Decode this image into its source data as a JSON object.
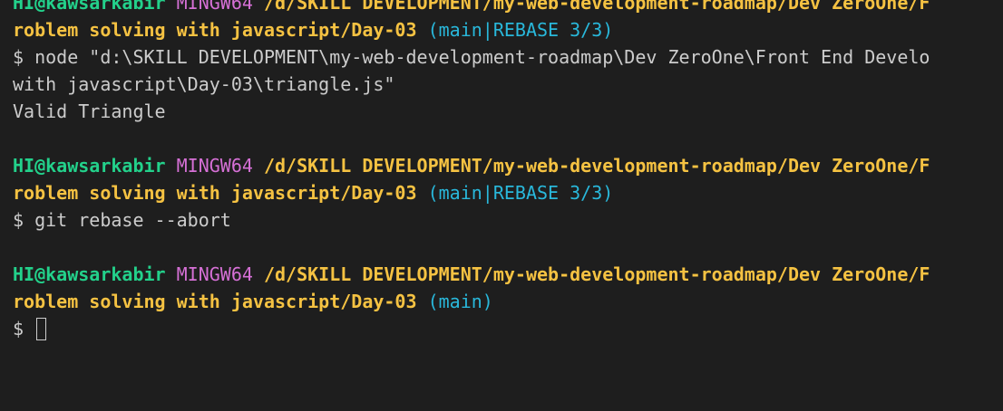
{
  "colors": {
    "background": "#1e1e1e",
    "user": "#23d18b",
    "host": "#d670d6",
    "path": "#f5c242",
    "branch": "#29b8db",
    "text": "#cccccc"
  },
  "block1": {
    "user": "HI@kawsarkabir",
    "host": "MINGW64",
    "path_line1": "/d/SKILL DEVELOPMENT/my-web-development-roadmap/Dev ZeroOne/F",
    "path_line2": "roblem solving with javascript/Day-03",
    "branch": "(main|REBASE 3/3)",
    "prompt": "$",
    "command_line1": "node \"d:\\SKILL DEVELOPMENT\\my-web-development-roadmap\\Dev ZeroOne\\Front End Develo",
    "command_line2": "with javascript\\Day-03\\triangle.js\"",
    "output": "Valid Triangle"
  },
  "block2": {
    "user": "HI@kawsarkabir",
    "host": "MINGW64",
    "path_line1": "/d/SKILL DEVELOPMENT/my-web-development-roadmap/Dev ZeroOne/F",
    "path_line2": "roblem solving with javascript/Day-03",
    "branch": "(main|REBASE 3/3)",
    "prompt": "$",
    "command": "git rebase --abort"
  },
  "block3": {
    "user": "HI@kawsarkabir",
    "host": "MINGW64",
    "path_line1": "/d/SKILL DEVELOPMENT/my-web-development-roadmap/Dev ZeroOne/F",
    "path_line2": "roblem solving with javascript/Day-03",
    "branch": "(main)",
    "prompt": "$"
  }
}
